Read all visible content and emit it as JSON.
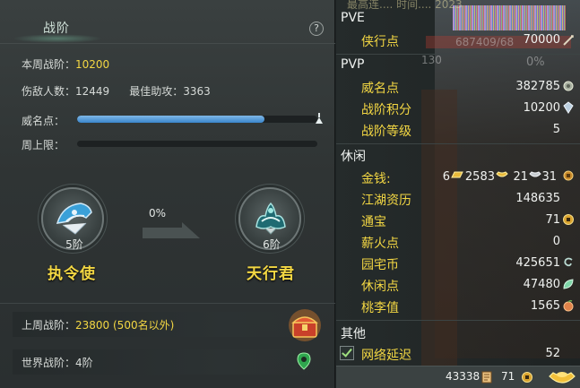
{
  "left_panel": {
    "title": "战阶",
    "help_label": "?",
    "weekly_rank": {
      "label": "本周战阶：",
      "value": "10200"
    },
    "stats": {
      "wounded_label": "伤敌人数：",
      "wounded_value": "12449",
      "assist_label": "最佳助攻：",
      "assist_value": "3363"
    },
    "prestige": {
      "label": "威名点：",
      "fill_fraction": 0.78
    },
    "weekly_cap": {
      "label": "周上限：",
      "fill_fraction": 0
    },
    "progress_percent": "0%",
    "current_rank": {
      "tier": "5阶",
      "name": "执令使"
    },
    "next_rank": {
      "tier": "6阶",
      "name": "天行君"
    },
    "last_week": {
      "label": "上周战阶：",
      "value": "23800 (500名以外)"
    },
    "world": {
      "label": "世界战阶：",
      "value": "4阶"
    }
  },
  "right_panel": {
    "ghost_top_text": "最高连.... 时间.... 2023",
    "ghost_pve_bar": "687409/68",
    "ghost_130": "130",
    "ghost_0pct": "0%",
    "pve": {
      "title": "PVE",
      "rows": [
        {
          "label": "侠行点",
          "value": "70000",
          "icon": "slash-icon"
        }
      ]
    },
    "pvp": {
      "title": "PVP",
      "rows": [
        {
          "label": "威名点",
          "value": "382785",
          "icon": "gear-flower-icon"
        },
        {
          "label": "战阶积分",
          "value": "10200",
          "icon": "crystal-icon"
        },
        {
          "label": "战阶等级",
          "value": "5"
        }
      ]
    },
    "leisure": {
      "title": "休闲",
      "money": {
        "label": "金钱:",
        "gold_bars": "6",
        "gold_ingot": "2583",
        "silver_ingot": "21",
        "copper": "31"
      },
      "rows": [
        {
          "label": "江湖资历",
          "value": "148635"
        },
        {
          "label": "通宝",
          "value": "71",
          "icon": "coin-icon"
        },
        {
          "label": "薪火点",
          "value": "0"
        },
        {
          "label": "园宅币",
          "value": "425651",
          "icon": "swirl-icon"
        },
        {
          "label": "休闲点",
          "value": "47480",
          "icon": "leaf-icon"
        },
        {
          "label": "桃李值",
          "value": "1565",
          "icon": "peach-icon"
        }
      ]
    },
    "other": {
      "title": "其他",
      "latency_label": "网络延迟",
      "latency_value": "52"
    },
    "bottom": {
      "left_value": "43338",
      "right_value": "71"
    }
  },
  "colors": {
    "accent_yellow": "#f3d743",
    "bar_blue": "#3a86cc",
    "panel_bg": "#2f3434"
  }
}
